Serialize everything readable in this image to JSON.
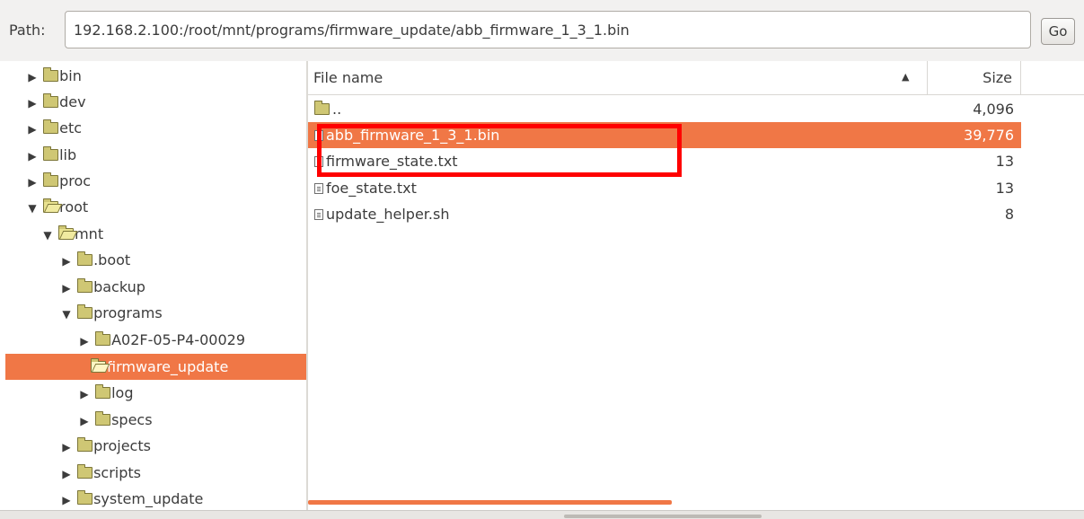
{
  "pathbar": {
    "label": "Path:",
    "value": "192.168.2.100:/root/mnt/programs/firmware_update/abb_firmware_1_3_1.bin",
    "go_label": "Go"
  },
  "tree": [
    {
      "label": "bin",
      "arrow": "▶"
    },
    {
      "label": "dev",
      "arrow": "▶"
    },
    {
      "label": "etc",
      "arrow": "▶"
    },
    {
      "label": "lib",
      "arrow": "▶"
    },
    {
      "label": "proc",
      "arrow": "▶"
    },
    {
      "label": "root",
      "arrow": "▼"
    },
    {
      "label": "mnt",
      "arrow": "▼"
    },
    {
      "label": ".boot",
      "arrow": "▶"
    },
    {
      "label": "backup",
      "arrow": "▶"
    },
    {
      "label": "programs",
      "arrow": "▼"
    },
    {
      "label": "A02F-05-P4-00029",
      "arrow": "▶"
    },
    {
      "label": "firmware_update",
      "arrow": ""
    },
    {
      "label": "log",
      "arrow": "▶"
    },
    {
      "label": "specs",
      "arrow": "▶"
    },
    {
      "label": "projects",
      "arrow": "▶"
    },
    {
      "label": "scripts",
      "arrow": "▶"
    },
    {
      "label": "system_update",
      "arrow": "▶"
    }
  ],
  "filelist": {
    "col_name": "File name",
    "col_size": "Size",
    "sort_indicator": "▲",
    "rows": [
      {
        "name": "..",
        "size": "4,096"
      },
      {
        "name": "abb_firmware_1_3_1.bin",
        "size": "39,776"
      },
      {
        "name": "firmware_state.txt",
        "size": "13"
      },
      {
        "name": "foe_state.txt",
        "size": "13"
      },
      {
        "name": "update_helper.sh",
        "size": "8"
      }
    ]
  },
  "colors": {
    "selection": "#f07746",
    "highlight_box": "#ff0000"
  }
}
